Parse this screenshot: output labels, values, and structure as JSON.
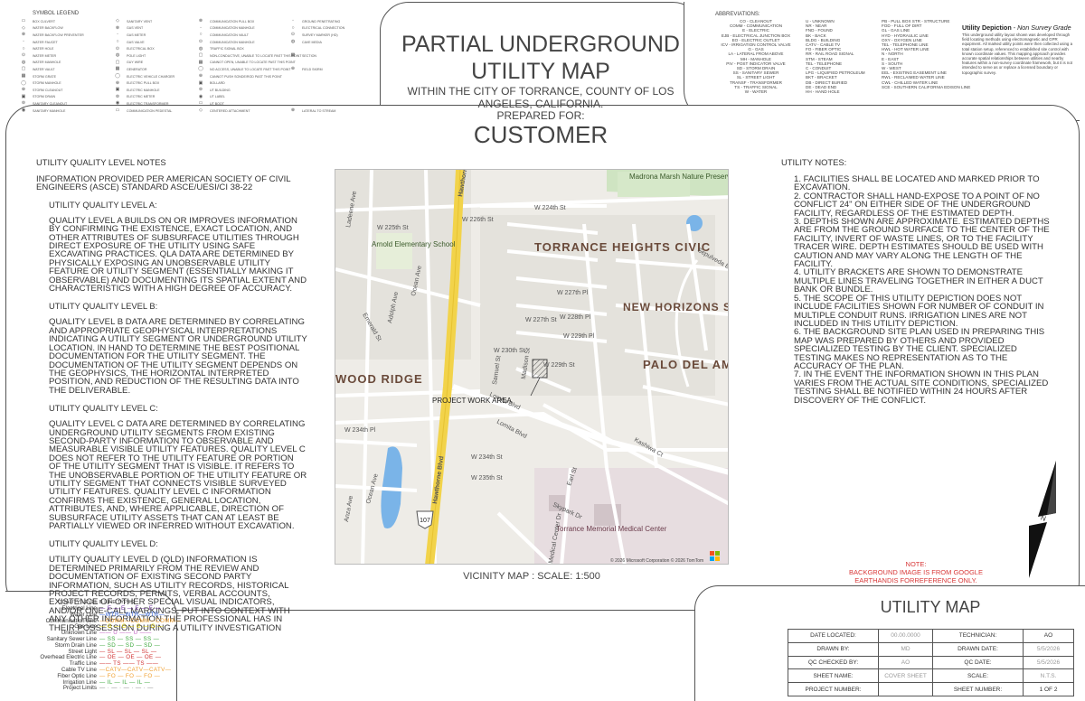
{
  "legend": {
    "title": "SYMBOL LEGEND",
    "col1": [
      "BOX CULVERT",
      "WATER BACKFLOW",
      "WATER BACKFLOW PREVENTER",
      "WATER FAUCET",
      "WATER HOLE",
      "WATER METER",
      "WATER MANHOLE",
      "WATER VAULT",
      "STORM GRATE",
      "STORM MANHOLE",
      "STORM CLEANOUT",
      "STORM DRAIN",
      "SANITARY CLEANOUT",
      "SANITARY MANHOLE"
    ],
    "col2": [
      "SANITARY VENT",
      "GAS VENT",
      "GAS METER",
      "GAS VALVE",
      "ELECTRICAL BOX",
      "POLE LIGHT",
      "GUY WIRE",
      "GENERATOR",
      "ELECTRIC VEHICLE CHARGER",
      "ELECTRIC PULL BOX",
      "ELECTRIC MANHOLE",
      "ELECTRIC METER",
      "ELECTRIC TRANSFORMER",
      "COMMUNICATION PEDESTAL"
    ],
    "col3": [
      "COMMUNICATION PULL BOX",
      "COMMUNICATION MANHOLE",
      "COMMUNICATION VAULT",
      "COMMUNICATION MANHOLE",
      "TRAFFIC SIGNAL BOX",
      "NON-CONDUCTIVE, UNABLE TO LOCATE PAST THIS POINT",
      "CANNOT OPEN, UNABLE TO LOCATE PAST THIS POINT",
      "NO ACCESS, UNABLE TO LOCATE PAST THIS POINT",
      "CANNOT PUSH SONDE/ROD PAST THIS POINT",
      "BOLLARD",
      "UT BUILDING",
      "UT LABEL",
      "UT BOOT",
      "CENTERED ATTACHMENT"
    ],
    "col4": [
      "GROUND PENETRATING",
      "ELECTRICAL CONNECTION",
      "SURVEY MARKER (HD)",
      "CAVE MEDIA",
      "",
      "SECTION",
      "",
      "FIELD SKIRM",
      "",
      "",
      "",
      "",
      "",
      "LATERAL TO STREAM"
    ],
    "extra": "CLOSURE OF METER LINES"
  },
  "title": {
    "line1": "PARTIAL UNDERGROUND",
    "line2": "UTILITY MAP",
    "sub": "WITHIN THE CITY OF TORRANCE, COUNTY OF LOS ANGELES, CALIFORNIA.",
    "prepared": "PREPARED FOR:",
    "customer": "CUSTOMER"
  },
  "abbreviations": {
    "heading": "ABBREVIATIONS:",
    "col1": [
      "CO - CLEANOUT",
      "COMM - COMMUNICATION",
      "E - ELECTRIC",
      "EJB - ELECTRICAL JUNCTION BOX",
      "EO - ELECTRIC OUTLET",
      "ICV - IRRIGATION CONTROL VALVE",
      "G - GAS",
      "LA - LATERAL FROM ABOVE",
      "MH - MANHOLE",
      "PIV - POST INDICATOR VALVE",
      "SD - STORM DRAIN",
      "SS - SANITARY SEWER",
      "SL - STREET LIGHT",
      "TRANSF - TRANSFORMER",
      "TS - TRAFFIC SIGNAL",
      "W - WATER"
    ],
    "col2": [
      "U - UNKNOWN",
      "NR - NEAR",
      "FND - FOUND",
      "BK - BACK",
      "BLDG - BUILDING",
      "CATV - CABLE TV",
      "FO - FIBER OPTIC",
      "RR - RAIL ROAD SIGNAL",
      "STM - STEAM",
      "TEL - TELEPHONE",
      "C - CONDUIT",
      "LPG - LIQUIFIED PETROLEUM",
      "BKT - BRACKET",
      "DB - DIRECT BURIED",
      "DE - DEAD END",
      "HH - HAND HOLE"
    ],
    "col3": [
      "PB - PULL BOX STR - STRUCTURE",
      "FOD - FULL OF DIRT",
      "GL - GAS LINE",
      "HYD - HYDRAULIC LINE",
      "OXY - OXYGEN LINE",
      "TEL - TELEPHONE LINE",
      "HWL - HOT WATER LINE",
      "N - NORTH",
      "E - EAST",
      "S - SOUTH",
      "W - WEST",
      "EEL - EXISTING EASEMENT LINE",
      "RWL - RECLAIMED WATER LINE",
      "CWL - CHILLED WATER LINE",
      "SCE - SOUTHERN CALIFORNIA EDISON LINE"
    ]
  },
  "depiction": {
    "title": "Utility Depiction",
    "grade": "Non Survey Grade",
    "text": "This underground utility layout shown was developed through field locating methods using electromagnetic and GPR equipment. All marked utility points were then collected using a total station setup, referenced to established site control with known coordinate values. This mapping approach provides accurate spatial relationships between utilities and nearby features within a non-survey coordinate framework, but it is not intended to serve as or replace a licensed boundary or topographic survey."
  },
  "quality": {
    "heading": "UTILITY QUALITY LEVEL NOTES",
    "intro": "INFORMATION PROVIDED PER AMERICAN SOCIETY OF CIVIL ENGINEERS (ASCE) STANDARD ASCE/UESI/CI 38-22",
    "levels": [
      {
        "title": "UTILITY QUALITY LEVEL A:",
        "text": "QUALITY LEVEL A BUILDS ON OR IMPROVES INFORMATION BY CONFIRMING THE EXISTENCE, EXACT LOCATION, AND OTHER ATTRIBUTES OF SUBSURFACE UTILITIES THROUGH DIRECT EXPOSURE OF THE UTILITY USING SAFE EXCAVATING PRACTICES. QLa DATA ARE DETERMINED BY PHYSICALLY EXPOSING AN UNOBSERVABLE UTILITY FEATURE OR UTILITY SEGMENT (ESSENTIALLY MAKING IT OBSERVABLE) AND DOCUMENTING ITS SPATIAL EXTENT AND CHARACTERISTICS WITH A HIGH DEGREE OF ACCURACY."
      },
      {
        "title": "UTILITY QUALITY LEVEL B:",
        "text": "QUALITY LEVEL B DATA ARE DETERMINED BY CORRELATING AND APPROPRIATE GEOPHYSICAL INTERPRETATIONS INDICATING A UTILITY SEGMENT OR UNDERGROUND UTILITY LOCATION. IN HAND TO DETERMINE THE BEST POSITIONAL DOCUMENTATION FOR THE UTILITY SEGMENT. THE DOCUMENTATION OF THE UTILITY SEGMENT DEPENDS ON THE GEOPHYSICS, THE HORIZONTAL INTERPRETED POSITION, AND REDUCTION OF THE RESULTING DATA INTO THE DELIVERABLE."
      },
      {
        "title": "UTILITY QUALITY LEVEL C:",
        "text": "QUALITY LEVEL C DATA ARE DETERMINED BY CORRELATING UNDERGROUND UTILITY SEGMENTS FROM EXISTING SECOND-PARTY INFORMATION TO OBSERVABLE AND MEASURABLE VISIBLE UTILITY FEATURES. QUALITY LEVEL C DOES NOT REFER TO THE UTILITY FEATURE OR PORTION OF THE UTILITY SEGMENT THAT IS VISIBLE. IT REFERS TO THE UNOBSERVABLE PORTION OF THE UTILITY FEATURE OR UTILITY SEGMENT THAT CONNECTS VISIBLE SURVEYED UTILITY FEATURES. QUALITY LEVEL C INFORMATION CONFIRMS THE EXISTENCE, GENERAL LOCATION, ATTRIBUTES, AND, WHERE APPLICABLE, DIRECTION OF SUBSURFACE UTILITY ASSETS THAT CAN AT LEAST BE PARTIALLY VIEWED OR INFERRED WITHOUT EXCAVATION."
      },
      {
        "title": "UTILITY QUALITY LEVEL D:",
        "text": "UTILITY QUALITY LEVEL D (QLD) INFORMATION IS DETERMINED PRIMARILY FROM THE REVIEW AND DOCUMENTATION OF EXISTING SECOND PARTY INFORMATION, SUCH AS UTILITY RECORDS, HISTORICAL PROJECT RECORDS, PERMITS, VERBAL ACCOUNTS, EXISTENCE OF OTHER SPECIAL VISUAL INDICATORS, AND/OR ONE-CALL MARKINGS, PUT INTO CONTEXT WITH ANY OTHER INFORMATION THE PROFESSIONAL HAS IN THEIR POSSESSION DURING A UTILITY INVESTIGATION"
      }
    ]
  },
  "map": {
    "labels": {
      "nature": "Madrona Marsh Nature Preserve",
      "civic": "TORRANCE HEIGHTS CIVIC",
      "nh": "NEW HORIZONS SOUTH BAY",
      "pdl": "PALO DEL AMO",
      "wood": "WOOD RIDGE",
      "arnold": "Arnold Elementary School",
      "torrmed": "Torrance Memorial Medical Center",
      "hawthorne1": "Hawthorne Blvd",
      "hawthorne2": "Hawthorne Blvd",
      "w224": "W 224th St",
      "w226": "W 226th St",
      "w225": "W 225th St",
      "w227": "W 227th Pl",
      "w227st": "W 227th St",
      "w228": "W 228th Pl",
      "w229": "W 229th Pl",
      "w229st": "W 229th St",
      "w230": "W 230th St",
      "w234pl": "W 234th Pl",
      "w234st": "W 234th St",
      "w235": "W 235th St",
      "lomita": "Lomita Blvd",
      "lomita2": "Lomita Blvd",
      "madison": "Madison St",
      "samuel": "Samuel St",
      "adolph": "Adolph Ave",
      "ocean": "Ocean Ave",
      "emerald": "Emerald St",
      "sepulveda": "Sepulveda Blvd",
      "skypark": "Skypark Dr",
      "medical": "Medical Center Dr",
      "kashiwa": "Kashiwa Ct",
      "earl": "Earl St",
      "ladeene": "Ladeene Ave",
      "anza": "Anza Ave",
      "ocean2": "Ocean Ave",
      "route": "107",
      "project": "PROJECT WORK AREA",
      "copyright": "© 2026 Microsoft Corporation © 2026 TomTom",
      "bing": "Microsoft Bing"
    },
    "caption": "VICINITY MAP : SCALE: 1:500",
    "note_title": "NOTE:",
    "note_text": "BACKGROUND IMAGE IS FROM GOOGLE EARTHANDIS FORREFERENCE ONLY."
  },
  "utility_notes": {
    "heading": "UTILITY NOTES:",
    "items": [
      "1. FACILITIES SHALL BE LOCATED AND MARKED PRIOR TO EXCAVATION.",
      "2. CONTRACTOR SHALL HAND-EXPOSE TO A POINT OF NO CONFLICT 24\" ON EITHER SIDE OF THE UNDERGROUND FACILITY, REGARDLESS OF THE ESTIMATED DEPTH.",
      "3. DEPTHS SHOWN ARE APPROXIMATE. ESTIMATED DEPTHS ARE FROM THE GROUND SURFACE TO THE CENTER OF THE FACILITY, INVERT OF WASTE LINES, OR TO THE FACILITY TRACER WIRE. DEPTH ESTIMATES SHOULD BE USED WITH CAUTION AND MAY VARY ALONG THE LENGTH OF THE FACILITY.",
      "4. UTILITY BRACKETS ARE SHOWN TO DEMONSTRATE MULTIPLE LINES TRAVELING TOGETHER IN EITHER A DUCT BANK OR BUNDLE.",
      "5. THE SCOPE OF THIS UTILITY DEPICTION DOES NOT INCLUDE FACILITIES SHOWN FOR NUMBER OF CONDUIT IN MULTIPLE CONDUIT RUNS. IRRIGATION LINES ARE NOT INCLUDED IN THIS UTILITY DEPICTION.",
      "6. THE BACKGROUND SITE PLAN USED IN PREPARING THIS MAP WAS PREPARED BY OTHERS AND PROVIDED SPECIALIZED TESTING BY THE CLIENT. SPECIALIZED TESTING MAKES NO REPRESENTATION AS TO THE ACCURACY OF THE PLAN.",
      "7. IN THE EVENT THE INFORMATION SHOWN IN THIS PLAN VARIES FROM THE ACTUAL SITE CONDITIONS, SPECIALIZED TESTING SHALL BE NOTIFIED WITHIN 24 HOURS AFTER DISCOVERY OF THE CONFLICT."
    ]
  },
  "north_arrow": {
    "label": "N"
  },
  "line_types": {
    "title": "QUALITY LEVEL B LINE TYPES",
    "rows": [
      {
        "name": "Electrical Line",
        "pattern": "— E — E — E — E —",
        "color": "#7030a0"
      },
      {
        "name": "Water Line",
        "pattern": "—WTR—WTR—WTR—",
        "color": "#2e5fd8"
      },
      {
        "name": "Communication Line",
        "pattern": "—COMM—COMM—COMM—",
        "color": "#f0a030"
      },
      {
        "name": "Gas Line",
        "pattern": "— G — G — G — G —",
        "color": "#e8d800"
      },
      {
        "name": "Unknown Line",
        "pattern": "—— U —— U ——",
        "color": "#c060c0"
      },
      {
        "name": "Sanitary Sewer Line",
        "pattern": "— SS — SS — SS —",
        "color": "#3ba83b"
      },
      {
        "name": "Storm Drain Line",
        "pattern": "— SD — SD — SD —",
        "color": "#3ba83b"
      },
      {
        "name": "Street Light",
        "pattern": "— SL — SL — SL —",
        "color": "#d03030"
      },
      {
        "name": "Overhead Electric Line",
        "pattern": "— OE — OE — OE —",
        "color": "#d03030"
      },
      {
        "name": "Traffic Line",
        "pattern": "—— TS —— TS ——",
        "color": "#d03030"
      },
      {
        "name": "Cable TV Line",
        "pattern": "—CATV—CATV—CATV—",
        "color": "#f0a030"
      },
      {
        "name": "Fiber Optic Line",
        "pattern": "— FO — FO — FO —",
        "color": "#f0a030"
      },
      {
        "name": "Irrigation Line",
        "pattern": "— IL — IL — IL —",
        "color": "#3ba83b"
      },
      {
        "name": "Project Limits",
        "pattern": "— · — · — · — · —",
        "color": "#888888"
      }
    ]
  },
  "title_block": {
    "title": "UTILITY MAP",
    "rows": [
      {
        "l1": "DATE LOCATED:",
        "v1": "00.00.0000",
        "l2": "TECHNICIAN:",
        "v2": "AO"
      },
      {
        "l1": "DRAWN BY:",
        "v1": "MD",
        "l2": "DRAWN DATE:",
        "v2": "5/5/2026"
      },
      {
        "l1": "QC CHECKED BY:",
        "v1": "AO",
        "l2": "QC DATE:",
        "v2": "5/5/2026"
      },
      {
        "l1": "SHEET NAME:",
        "v1": "COVER SHEET",
        "l2": "SCALE:",
        "v2": "N.T.S."
      },
      {
        "l1": "PROJECT NUMBER:",
        "v1": "",
        "l2": "SHEET NUMBER:",
        "v2": "1 OF 2"
      }
    ]
  }
}
